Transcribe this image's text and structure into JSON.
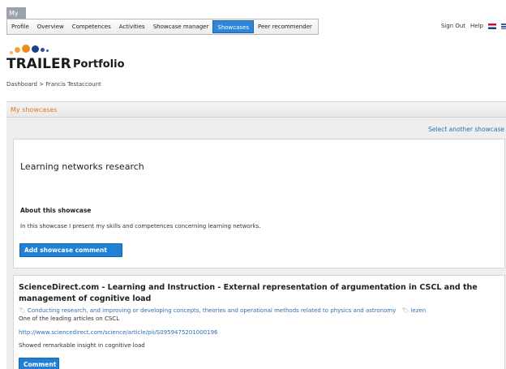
{
  "header": {
    "my_tab": "My",
    "nav": [
      "Profile",
      "Overview",
      "Competences",
      "Activities",
      "Showcase manager",
      "Showcases",
      "Peer recommender"
    ],
    "active_index": 5,
    "sign_out": "Sign Out",
    "help": "Help"
  },
  "logo": {
    "wordmark": "TRAILER",
    "sub": "Portfolio"
  },
  "breadcrumb": "Dashboard > Francis Testaccount",
  "section": {
    "title": "My showcases",
    "select_link": "Select another showcase"
  },
  "showcase": {
    "title": "Learning networks research",
    "about_label": "About this showcase",
    "about_text": "In this showcase I present my skills and competences concerning learning networks.",
    "add_comment": "Add showcase comment"
  },
  "item": {
    "title": "ScienceDirect.com - Learning and Instruction - External representation of argumentation in CSCL and the management of cognitive load",
    "tags": [
      "Conducting research, and improving or developing concepts, theories and operational methods related to physics and astronomy",
      "lezen"
    ],
    "description": "One of the leading articles on CSCL",
    "url": "http://www.sciencedirect.com/science/article/pii/S0959475201000196",
    "remark": "Showed remarkable insight in cognitive load",
    "comment": "Comment"
  },
  "colors": {
    "accent": "#1f80d6",
    "section_title": "#e07a1f",
    "link": "#2d6fb3"
  }
}
